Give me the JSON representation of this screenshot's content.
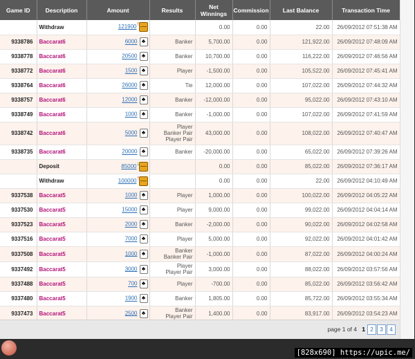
{
  "header": {
    "game_id": "Game ID",
    "description": "Description",
    "amount": "Amount",
    "results": "Results",
    "net_winnings": "Net Winnings",
    "commission": "Commission",
    "last_balance": "Last Balance",
    "transaction_time": "Transaction Time"
  },
  "rows": [
    {
      "game_id": "",
      "desc": "Withdraw",
      "type": "withdraw",
      "amount": "121900",
      "icon": "withdraw-chest-icon",
      "results": [],
      "net": "0.00",
      "comm": "0.00",
      "bal": "22.00",
      "time": "26/09/2012 07:51:38 AM"
    },
    {
      "game_id": "9338786",
      "desc": "Baccarat6",
      "type": "game",
      "amount": "6000",
      "icon": "club-card-icon",
      "results": [
        "Banker"
      ],
      "net": "5,700.00",
      "comm": "0.00",
      "bal": "121,922.00",
      "time": "26/09/2012 07:48:09 AM"
    },
    {
      "game_id": "9338778",
      "desc": "Baccarat6",
      "type": "game",
      "amount": "20500",
      "icon": "club-card-icon",
      "results": [
        "Banker"
      ],
      "net": "10,700.00",
      "comm": "0.00",
      "bal": "116,222.00",
      "time": "26/09/2012 07:46:56 AM"
    },
    {
      "game_id": "9338772",
      "desc": "Baccarat6",
      "type": "game",
      "amount": "1500",
      "icon": "club-card-icon",
      "results": [
        "Player"
      ],
      "net": "-1,500.00",
      "comm": "0.00",
      "bal": "105,522.00",
      "time": "26/09/2012 07:45:41 AM"
    },
    {
      "game_id": "9338764",
      "desc": "Baccarat6",
      "type": "game",
      "amount": "26000",
      "icon": "club-card-icon",
      "results": [
        "Tie"
      ],
      "net": "12,000.00",
      "comm": "0.00",
      "bal": "107,022.00",
      "time": "26/09/2012 07:44:32 AM"
    },
    {
      "game_id": "9338757",
      "desc": "Baccarat6",
      "type": "game",
      "amount": "12000",
      "icon": "club-card-icon",
      "results": [
        "Banker"
      ],
      "net": "-12,000.00",
      "comm": "0.00",
      "bal": "95,022.00",
      "time": "26/09/2012 07:43:10 AM"
    },
    {
      "game_id": "9338749",
      "desc": "Baccarat6",
      "type": "game",
      "amount": "1000",
      "icon": "club-card-icon",
      "results": [
        "Banker"
      ],
      "net": "-1,000.00",
      "comm": "0.00",
      "bal": "107,022.00",
      "time": "26/09/2012 07:41:59 AM"
    },
    {
      "game_id": "9338742",
      "desc": "Baccarat6",
      "type": "game",
      "amount": "5000",
      "icon": "club-card-icon",
      "results": [
        "Player",
        "Banker Pair",
        "Player Pair"
      ],
      "net": "43,000.00",
      "comm": "0.00",
      "bal": "108,022.00",
      "time": "26/09/2012 07:40:47 AM"
    },
    {
      "game_id": "9338735",
      "desc": "Baccarat6",
      "type": "game",
      "amount": "20000",
      "icon": "club-card-icon",
      "results": [
        "Banker"
      ],
      "net": "-20,000.00",
      "comm": "0.00",
      "bal": "65,022.00",
      "time": "26/09/2012 07:39:26 AM"
    },
    {
      "game_id": "",
      "desc": "Deposit",
      "type": "deposit",
      "amount": "85000",
      "icon": "deposit-chest-icon",
      "results": [],
      "net": "0.00",
      "comm": "0.00",
      "bal": "85,022.00",
      "time": "26/09/2012 07:36:17 AM"
    },
    {
      "game_id": "",
      "desc": "Withdraw",
      "type": "withdraw",
      "amount": "100000",
      "icon": "withdraw-chest-icon",
      "results": [],
      "net": "0.00",
      "comm": "0.00",
      "bal": "22.00",
      "time": "26/09/2012 04:10:49 AM"
    },
    {
      "game_id": "9337538",
      "desc": "Baccarat5",
      "type": "game",
      "amount": "1000",
      "icon": "club-card-icon",
      "results": [
        "Player"
      ],
      "net": "1,000.00",
      "comm": "0.00",
      "bal": "100,022.00",
      "time": "26/09/2012 04:05:22 AM"
    },
    {
      "game_id": "9337530",
      "desc": "Baccarat5",
      "type": "game",
      "amount": "15000",
      "icon": "club-card-icon",
      "results": [
        "Player"
      ],
      "net": "9,000.00",
      "comm": "0.00",
      "bal": "99,022.00",
      "time": "26/09/2012 04:04:14 AM"
    },
    {
      "game_id": "9337523",
      "desc": "Baccarat5",
      "type": "game",
      "amount": "2000",
      "icon": "club-card-icon",
      "results": [
        "Banker"
      ],
      "net": "-2,000.00",
      "comm": "0.00",
      "bal": "90,022.00",
      "time": "26/09/2012 04:02:58 AM"
    },
    {
      "game_id": "9337516",
      "desc": "Baccarat5",
      "type": "game",
      "amount": "7000",
      "icon": "club-card-icon",
      "results": [
        "Player"
      ],
      "net": "5,000.00",
      "comm": "0.00",
      "bal": "92,022.00",
      "time": "26/09/2012 04:01:42 AM"
    },
    {
      "game_id": "9337508",
      "desc": "Baccarat5",
      "type": "game",
      "amount": "1000",
      "icon": "club-card-icon",
      "results": [
        "Banker",
        "Banker Pair"
      ],
      "net": "-1,000.00",
      "comm": "0.00",
      "bal": "87,022.00",
      "time": "26/09/2012 04:00:24 AM"
    },
    {
      "game_id": "9337492",
      "desc": "Baccarat5",
      "type": "game",
      "amount": "3000",
      "icon": "club-card-icon",
      "results": [
        "Player",
        "Player Pair"
      ],
      "net": "3,000.00",
      "comm": "0.00",
      "bal": "88,022.00",
      "time": "26/09/2012 03:57:56 AM"
    },
    {
      "game_id": "9337488",
      "desc": "Baccarat5",
      "type": "game",
      "amount": "700",
      "icon": "club-card-icon",
      "results": [
        "Player"
      ],
      "net": "-700.00",
      "comm": "0.00",
      "bal": "85,022.00",
      "time": "26/09/2012 03:56:42 AM"
    },
    {
      "game_id": "9337480",
      "desc": "Baccarat5",
      "type": "game",
      "amount": "1900",
      "icon": "club-card-icon",
      "results": [
        "Banker"
      ],
      "net": "1,805.00",
      "comm": "0.00",
      "bal": "85,722.00",
      "time": "26/09/2012 03:55:34 AM"
    },
    {
      "game_id": "9337473",
      "desc": "Baccarat5",
      "type": "game",
      "amount": "2500",
      "icon": "club-card-icon",
      "results": [
        "Banker",
        "Player Pair"
      ],
      "net": "1,400.00",
      "comm": "0.00",
      "bal": "83,917.00",
      "time": "26/09/2012 03:54:23 AM"
    }
  ],
  "pager": {
    "label": "page 1 of 4",
    "current": "1",
    "pages": [
      "2",
      "3",
      "4"
    ]
  },
  "icons": {
    "card_glyph": "♣",
    "withdraw_arrow": "↑",
    "deposit_arrow": "↓"
  },
  "colors": {
    "header_bg": "#5a5a5a",
    "game_link": "#b3127a",
    "amount_link": "#2c6fb5",
    "row_alt": "#fdf2ec"
  },
  "watermark": "[828x690] https://upic.me/"
}
